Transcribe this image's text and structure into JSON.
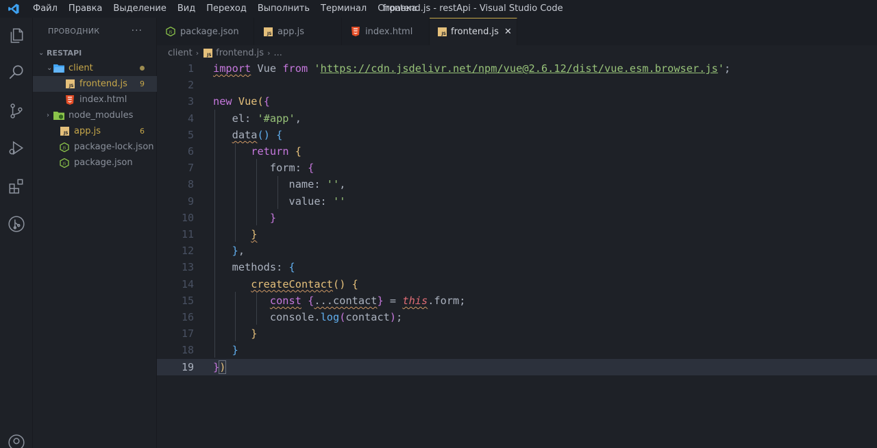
{
  "titlebar": {
    "menu": [
      "Файл",
      "Правка",
      "Выделение",
      "Вид",
      "Переход",
      "Выполнить",
      "Терминал",
      "Справка"
    ],
    "window_title": "frontend.js - restApi - Visual Studio Code"
  },
  "activitybar": {
    "icons": [
      "explorer-icon",
      "search-icon",
      "source-control-icon",
      "run-debug-icon",
      "extensions-icon",
      "git-graph-icon",
      "account-icon"
    ]
  },
  "sidebar": {
    "title": "ПРОВОДНИК",
    "more": "···",
    "root": "RESTAPI",
    "items": [
      {
        "label": "client",
        "badge": ""
      },
      {
        "label": "frontend.js",
        "badge": "9"
      },
      {
        "label": "index.html",
        "badge": ""
      },
      {
        "label": "node_modules",
        "badge": ""
      },
      {
        "label": "app.js",
        "badge": "6"
      },
      {
        "label": "package-lock.json",
        "badge": ""
      },
      {
        "label": "package.json",
        "badge": ""
      }
    ]
  },
  "tabs": [
    {
      "label": "package.json",
      "icon": "node-icon"
    },
    {
      "label": "app.js",
      "icon": "js-icon"
    },
    {
      "label": "index.html",
      "icon": "html-icon"
    },
    {
      "label": "frontend.js",
      "icon": "js-icon",
      "active": true
    }
  ],
  "breadcrumb": {
    "folder": "client",
    "file": "frontend.js",
    "more": "..."
  },
  "editor": {
    "line_numbers": [
      "1",
      "2",
      "3",
      "4",
      "5",
      "6",
      "7",
      "8",
      "9",
      "10",
      "11",
      "12",
      "13",
      "14",
      "15",
      "16",
      "17",
      "18",
      "19"
    ],
    "current_line": 19
  },
  "colors": {
    "background": "#1e2127",
    "keyword": "#c678dd",
    "string": "#98c379",
    "function": "#e5c07b",
    "accent": "#c8a84a"
  }
}
